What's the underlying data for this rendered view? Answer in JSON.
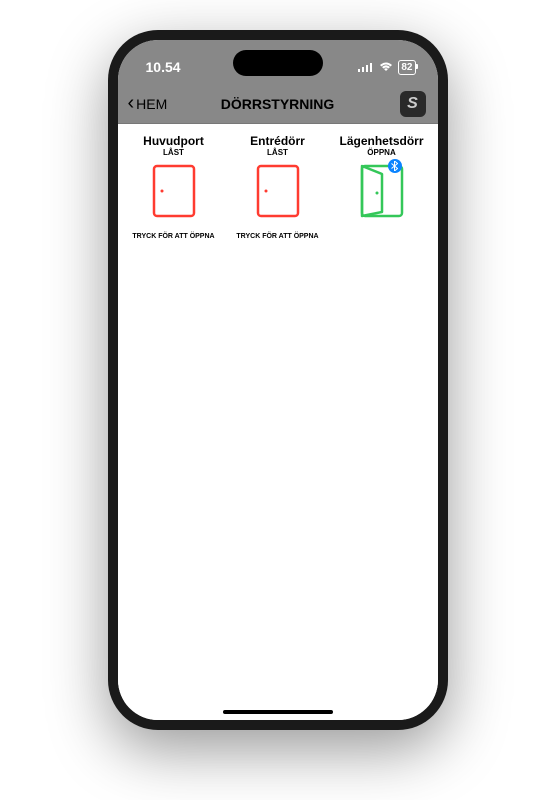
{
  "status_bar": {
    "time": "10.54",
    "battery": "82"
  },
  "nav": {
    "back_label": "HEM",
    "title": "DÖRRSTYRNING"
  },
  "doors": [
    {
      "name": "Huvudport",
      "status": "LÅST",
      "hint": "TRYCK FÖR ATT ÖPPNA",
      "state": "locked"
    },
    {
      "name": "Entrédörr",
      "status": "LÅST",
      "hint": "TRYCK FÖR ATT ÖPPNA",
      "state": "locked"
    },
    {
      "name": "Lägenhetsdörr",
      "status": "ÖPPNA",
      "hint": "",
      "state": "open"
    }
  ],
  "colors": {
    "locked": "#ff3b30",
    "open": "#34c759",
    "status_bg": "#888888"
  }
}
